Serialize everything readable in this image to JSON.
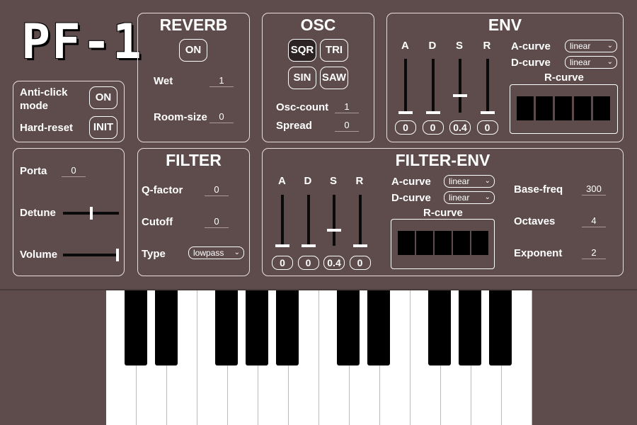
{
  "logo": "PF-1",
  "general": {
    "anticlick_label": "Anti-click mode",
    "anticlick_value": "ON",
    "hardreset_label": "Hard-reset",
    "hardreset_value": "INIT"
  },
  "reverb": {
    "title": "REVERB",
    "toggle": "ON",
    "wet_label": "Wet",
    "wet_value": "1",
    "roomsize_label": "Room-size",
    "roomsize_value": "0"
  },
  "osc": {
    "title": "OSC",
    "waves": [
      "SQR",
      "TRI",
      "SIN",
      "SAW"
    ],
    "selected_wave": "SQR",
    "count_label": "Osc-count",
    "count_value": "1",
    "spread_label": "Spread",
    "spread_value": "0"
  },
  "env": {
    "title": "ENV",
    "sliders": [
      {
        "label": "A",
        "value": "0",
        "level": 0
      },
      {
        "label": "D",
        "value": "0",
        "level": 0
      },
      {
        "label": "S",
        "value": "0.4",
        "level": 0.4
      },
      {
        "label": "R",
        "value": "0",
        "level": 0
      }
    ],
    "acurve_label": "A-curve",
    "acurve_value": "linear",
    "dcurve_label": "D-curve",
    "dcurve_value": "linear",
    "rcurve_label": "R-curve"
  },
  "voice": {
    "porta_label": "Porta",
    "porta_value": "0",
    "detune_label": "Detune",
    "detune_level": 0.5,
    "volume_label": "Volume",
    "volume_level": 1.0
  },
  "filter": {
    "title": "FILTER",
    "q_label": "Q-factor",
    "q_value": "0",
    "cutoff_label": "Cutoff",
    "cutoff_value": "0",
    "type_label": "Type",
    "type_value": "lowpass"
  },
  "filterenv": {
    "title": "FILTER-ENV",
    "sliders": [
      {
        "label": "A",
        "value": "0",
        "level": 0
      },
      {
        "label": "D",
        "value": "0",
        "level": 0
      },
      {
        "label": "S",
        "value": "0.4",
        "level": 0.4
      },
      {
        "label": "R",
        "value": "0",
        "level": 0
      }
    ],
    "acurve_label": "A-curve",
    "acurve_value": "linear",
    "dcurve_label": "D-curve",
    "dcurve_value": "linear",
    "rcurve_label": "R-curve",
    "basefreq_label": "Base-freq",
    "basefreq_value": "300",
    "octaves_label": "Octaves",
    "octaves_value": "4",
    "exponent_label": "Exponent",
    "exponent_value": "2"
  }
}
